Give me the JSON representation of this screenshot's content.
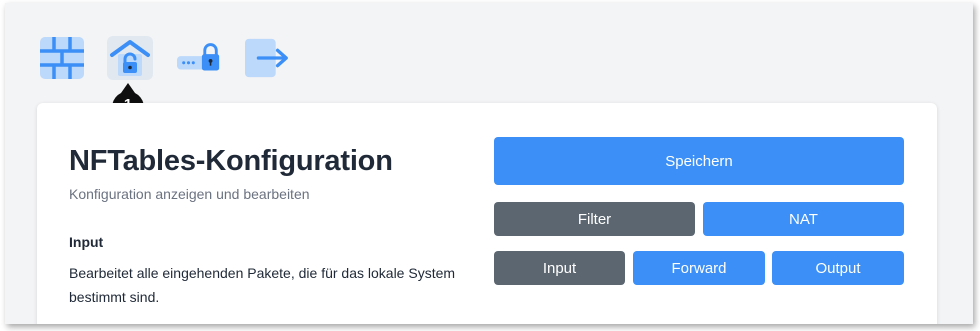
{
  "toolbar": {
    "items": [
      {
        "icon": "firewall-icon",
        "active": false
      },
      {
        "icon": "unlock-home-icon",
        "active": true
      },
      {
        "icon": "password-lock-icon",
        "active": false
      },
      {
        "icon": "logout-icon",
        "active": false
      }
    ],
    "marker": "1",
    "accent": "#3b8ff6"
  },
  "config": {
    "title": "NFTables-Konfiguration",
    "subtitle": "Konfiguration anzeigen und bearbeiten",
    "section_title": "Input",
    "section_description": "Bearbeitet alle eingehenden Pakete, die für das lokale System bestimmt sind."
  },
  "actions": {
    "save_label": "Speichern",
    "filter_label": "Filter",
    "nat_label": "NAT",
    "input_label": "Input",
    "forward_label": "Forward",
    "output_label": "Output"
  },
  "colors": {
    "primary": "#3b8ff6",
    "selected": "#5b6670",
    "heading": "#1f2937",
    "muted": "#6b7280"
  }
}
